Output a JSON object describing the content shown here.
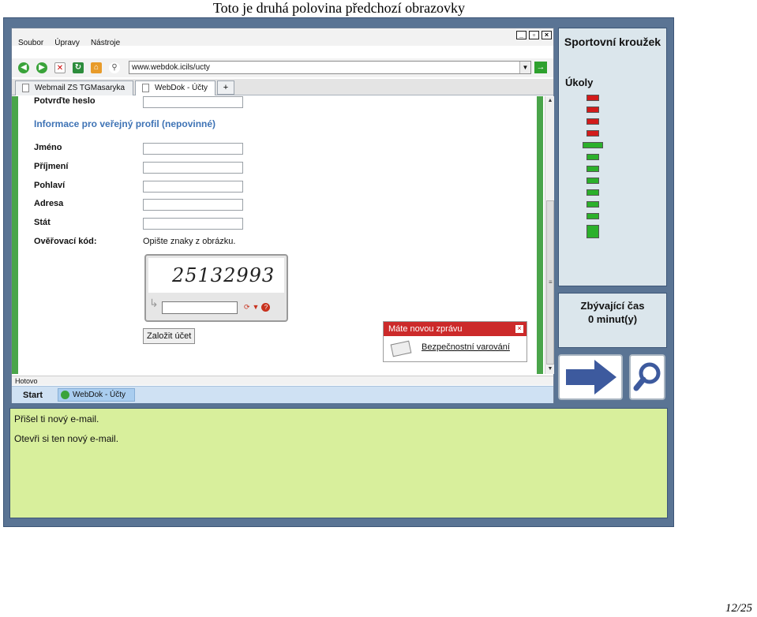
{
  "doc_title": "Toto je druhá polovina předchozí obrazovky",
  "page_number": "12/25",
  "browser": {
    "menu": [
      "Soubor",
      "Úpravy",
      "Nástroje"
    ],
    "url": "www.webdok.icils/ucty",
    "tabs": [
      "Webmail ZS TGMasaryka",
      "WebDok - Účty"
    ],
    "new_tab": "+",
    "status": "Hotovo",
    "start": "Start",
    "taskbar_item": "WebDok - Účty"
  },
  "form": {
    "confirm_password_label": "Potvrďte heslo",
    "section_heading": "Informace pro veřejný profil (nepovinné)",
    "first_name_label": "Jméno",
    "last_name_label": "Příjmení",
    "gender_label": "Pohlaví",
    "address_label": "Adresa",
    "country_label": "Stát",
    "verification_label": "Ověřovací kód:",
    "captcha_hint": "Opište znaky z obrázku.",
    "captcha_text": "25132993",
    "submit_label": "Založit účet"
  },
  "notification": {
    "title": "Máte novou zprávu",
    "link": "Bezpečnostní varování"
  },
  "side": {
    "title": "Sportovní kroužek",
    "tasks_label": "Úkoly",
    "time_title": "Zbývající čas",
    "time_value": "0 minut(y)"
  },
  "tasks": [
    {
      "status": "red"
    },
    {
      "status": "red"
    },
    {
      "status": "red"
    },
    {
      "status": "red"
    },
    {
      "status": "green",
      "current": true
    },
    {
      "status": "green"
    },
    {
      "status": "green"
    },
    {
      "status": "green"
    },
    {
      "status": "green"
    },
    {
      "status": "green"
    },
    {
      "status": "green"
    },
    {
      "status": "green",
      "final": true
    }
  ],
  "messages": [
    "Přišel ti nový e-mail.",
    "Otevři si ten nový e-mail."
  ],
  "colors": {
    "slide_frame": "#5a7494",
    "task_red": "#d21b1b",
    "task_green": "#2bb02b",
    "message_bg": "#d8ef9c",
    "arrow": "#3d5a9e"
  }
}
